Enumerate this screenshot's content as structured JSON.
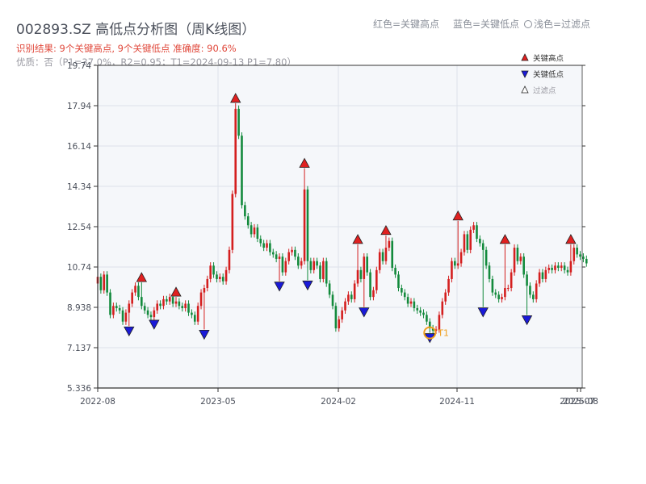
{
  "title": "002893.SZ 高低点分析图（周K线图）",
  "subtitle_result": "识别结果: 9个关键高点, 9个关键低点  准确度: 90.6%",
  "subtitle_quality": "优质：否（P1=37.0%，R2=0.95；T1=2024-09-13 P1=7.80）",
  "header_legend": {
    "red_label": "红色=关键高点",
    "blue_label": "蓝色=关键低点",
    "light_label": "浅色=过滤点"
  },
  "chart_data": {
    "type": "candlestick",
    "ylim": [
      5.336,
      19.74
    ],
    "y_ticks": [
      "5.336",
      "7.137",
      "8.938",
      "10.74",
      "12.54",
      "14.34",
      "16.14",
      "17.94",
      "19.74"
    ],
    "x_ticks": [
      "2022-08",
      "2023-05",
      "2024-02",
      "2024-11",
      "2025-07",
      "2025-08"
    ],
    "legend": [
      {
        "label": "关键高点",
        "color": "#e02020",
        "marker": "triangle-up"
      },
      {
        "label": "关键低点",
        "color": "#1a1ad8",
        "marker": "triangle-down"
      },
      {
        "label": "过滤点",
        "color": "#ffffff",
        "marker": "triangle-up"
      }
    ],
    "colors": {
      "up": "#d41f1f",
      "down": "#138a3c"
    },
    "week_count": 155,
    "candles_close": [
      10.3,
      9.7,
      10.4,
      9.6,
      8.6,
      9.0,
      8.9,
      8.8,
      8.3,
      8.7,
      9.1,
      9.6,
      9.9,
      9.4,
      9.0,
      8.8,
      8.6,
      8.5,
      8.8,
      9.1,
      9.0,
      9.3,
      9.2,
      9.4,
      9.1,
      9.2,
      9.0,
      8.9,
      9.1,
      8.7,
      8.6,
      8.3,
      9.0,
      9.6,
      9.8,
      10.2,
      10.8,
      10.4,
      10.2,
      10.3,
      10.1,
      10.6,
      11.5,
      14.0,
      17.8,
      16.6,
      13.5,
      13.0,
      12.6,
      12.2,
      12.5,
      12.0,
      11.8,
      11.6,
      11.8,
      11.4,
      11.3,
      11.1,
      11.2,
      10.5,
      11.0,
      11.4,
      11.5,
      11.2,
      10.8,
      11.0,
      14.2,
      11.0,
      10.6,
      11.0,
      10.8,
      10.2,
      11.0,
      10.0,
      9.5,
      9.0,
      8.0,
      8.4,
      8.8,
      9.2,
      9.5,
      9.3,
      10.0,
      10.6,
      10.2,
      11.2,
      10.5,
      9.4,
      9.7,
      10.6,
      11.4,
      11.0,
      11.6,
      11.9,
      10.7,
      10.4,
      9.8,
      9.6,
      9.4,
      9.1,
      9.2,
      8.9,
      8.8,
      8.7,
      8.6,
      8.3,
      8.0,
      7.9,
      7.95,
      8.6,
      9.2,
      9.6,
      10.2,
      11.0,
      10.8,
      10.9,
      11.4,
      12.2,
      11.5,
      12.4,
      12.6,
      12.0,
      11.8,
      11.5,
      10.8,
      10.2,
      9.6,
      9.5,
      9.3,
      9.4,
      9.8,
      9.8,
      10.5,
      11.6,
      11.0,
      11.2,
      10.4,
      9.9,
      9.5,
      9.3,
      10.0,
      10.5,
      10.2,
      10.6,
      10.7,
      10.6,
      10.8,
      10.7,
      10.8,
      10.6,
      10.5,
      11.0,
      11.6,
      11.3,
      11.2,
      11.1,
      10.9
    ],
    "key_highs": [
      {
        "week": 14,
        "price": 10.05
      },
      {
        "week": 25,
        "price": 9.4
      },
      {
        "week": 44,
        "price": 18.05
      },
      {
        "week": 66,
        "price": 15.15
      },
      {
        "week": 83,
        "price": 11.75
      },
      {
        "week": 92,
        "price": 12.15
      },
      {
        "week": 115,
        "price": 12.8
      },
      {
        "week": 130,
        "price": 11.75
      },
      {
        "week": 151,
        "price": 11.75
      }
    ],
    "key_lows": [
      {
        "week": 10,
        "price": 8.1
      },
      {
        "week": 18,
        "price": 8.4
      },
      {
        "week": 34,
        "price": 7.95
      },
      {
        "week": 58,
        "price": 10.1
      },
      {
        "week": 67,
        "price": 10.15
      },
      {
        "week": 85,
        "price": 8.95
      },
      {
        "week": 106,
        "price": 7.8
      },
      {
        "week": 123,
        "price": 8.95
      },
      {
        "week": 137,
        "price": 8.6
      }
    ],
    "t1_marker": {
      "week": 106,
      "price": 7.8,
      "label": "T1"
    }
  }
}
